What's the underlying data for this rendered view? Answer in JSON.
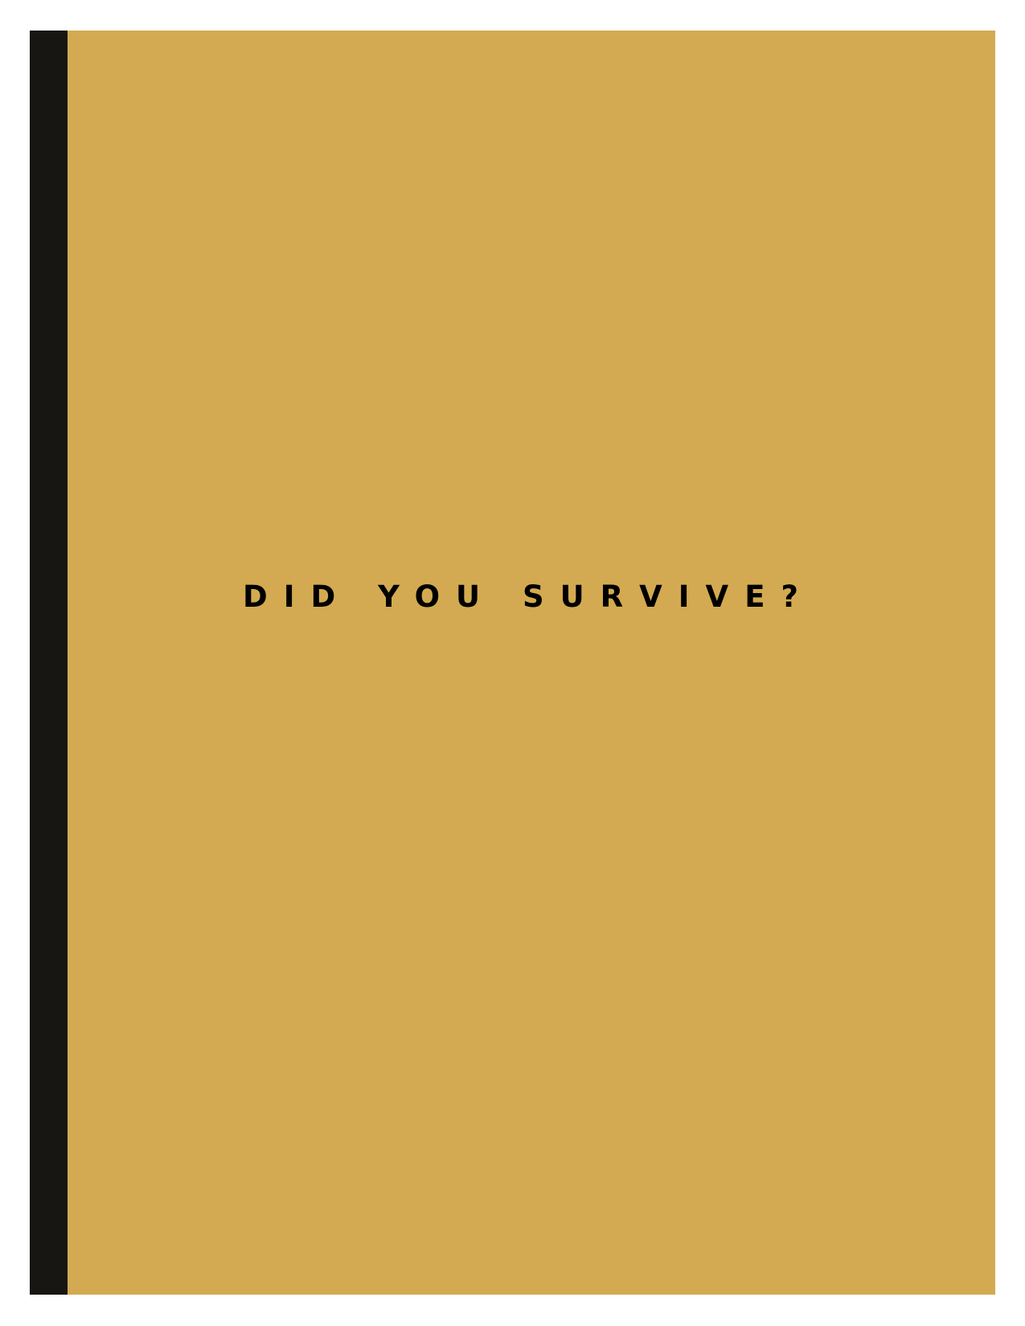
{
  "page": {
    "title": "DID YOU SURVIVE?"
  },
  "colors": {
    "background": "#ffffff",
    "spine": "#171612",
    "cover": "#d3aa51",
    "title_text": "#000000"
  }
}
